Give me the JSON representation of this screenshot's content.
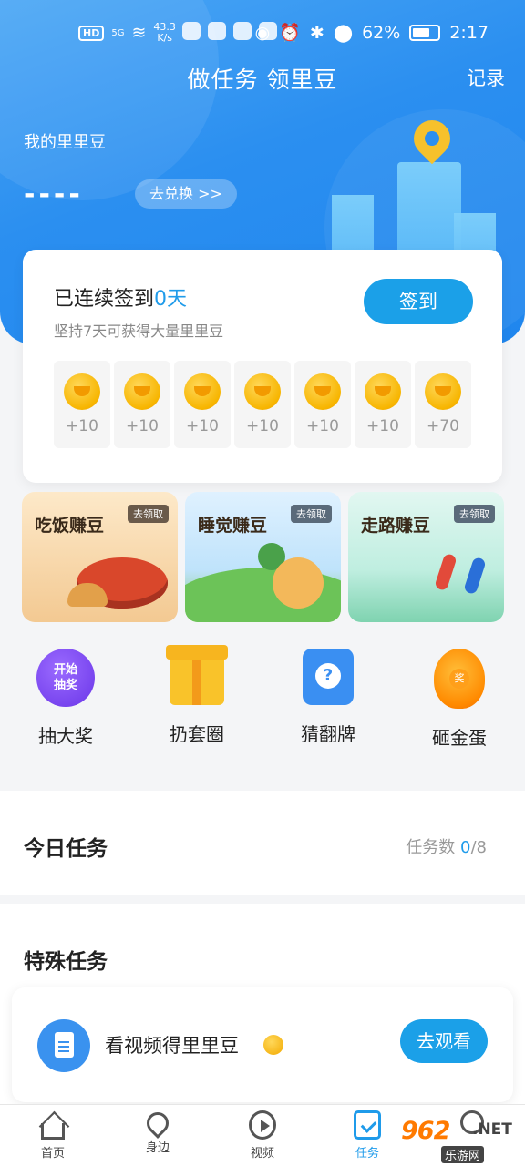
{
  "status_bar": {
    "network": "HD",
    "signal": "5G",
    "speed_value": "43.3",
    "speed_unit": "K/s",
    "battery": "62%",
    "time": "2:17"
  },
  "header": {
    "title": "做任务 领里豆",
    "record": "记录"
  },
  "beans": {
    "label": "我的里里豆",
    "value": "----",
    "exchange": "去兑换 >>"
  },
  "signin": {
    "prefix": "已连续签到",
    "days": "0天",
    "subtitle": "坚持7天可获得大量里里豆",
    "button": "签到",
    "rewards": [
      "+10",
      "+10",
      "+10",
      "+10",
      "+10",
      "+10",
      "+70"
    ]
  },
  "earn": [
    {
      "title": "吃饭赚豆",
      "tag": "去领取"
    },
    {
      "title": "睡觉赚豆",
      "tag": "去领取"
    },
    {
      "title": "走路赚豆",
      "tag": "去领取"
    }
  ],
  "games": {
    "lottery_badge": "开始\n抽奖",
    "lottery_badge_1": "开始",
    "lottery_badge_2": "抽奖",
    "egg_badge": "奖",
    "flip_badge": "?",
    "labels": [
      "抽大奖",
      "扔套圈",
      "猜翻牌",
      "砸金蛋"
    ]
  },
  "today": {
    "title": "今日任务",
    "count_label": "任务数",
    "done": "0",
    "total": "/8"
  },
  "special": {
    "title": "特殊任务",
    "item_label": "看视频得里里豆",
    "button": "去观看"
  },
  "tabs": [
    {
      "label": "首页",
      "icon": "home-icon"
    },
    {
      "label": "身边",
      "icon": "location-icon"
    },
    {
      "label": "视频",
      "icon": "play-icon"
    },
    {
      "label": "任务",
      "icon": "task-icon",
      "active": true
    },
    {
      "label": "",
      "icon": "profile-icon"
    }
  ],
  "watermark": {
    "logo": "962",
    "suffix": ".NET",
    "sub": "乐游网"
  },
  "colors": {
    "primary": "#1f9bea",
    "hero": "#2b8ff0",
    "coin": "#f7b500"
  }
}
